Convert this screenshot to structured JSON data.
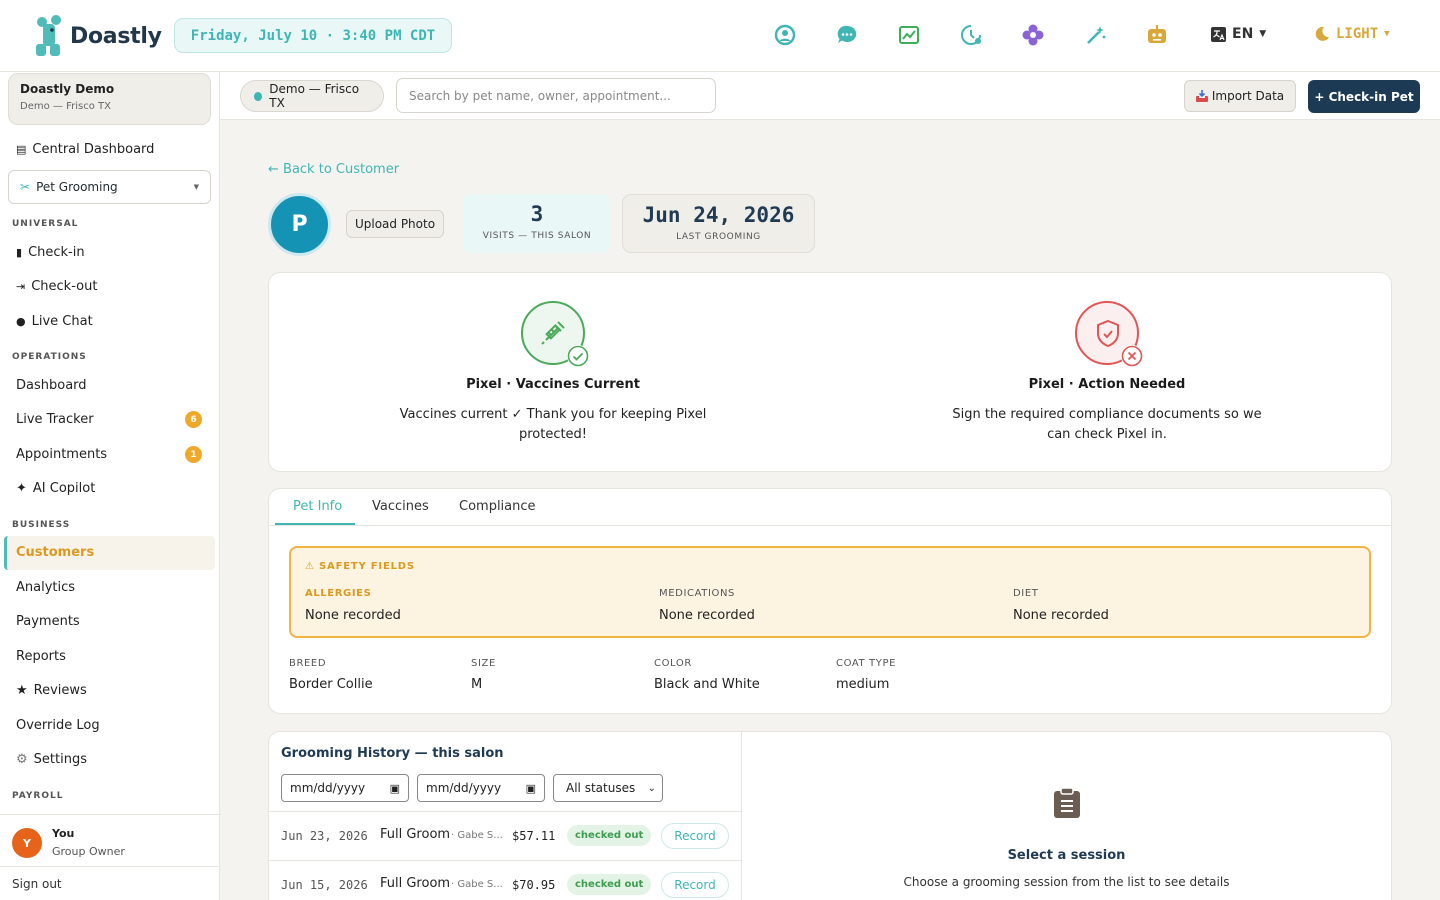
{
  "app": {
    "name": "Doastly",
    "datetime": "Friday, July 10 · 3:40 PM CDT"
  },
  "topbar": {
    "lang": "EN",
    "theme": "LIGHT",
    "icons": [
      "user-circle-icon",
      "chat-bubble-icon",
      "chart-icon",
      "clock-icon",
      "flower-icon",
      "magic-wand-icon",
      "robot-icon"
    ]
  },
  "sidebar": {
    "org_name": "Doastly Demo",
    "org_sub": "Demo — Frisco TX",
    "central": "Central Dashboard",
    "module": "Pet Grooming",
    "sections": {
      "universal": "UNIVERSAL",
      "operations": "OPERATIONS",
      "business": "BUSINESS",
      "payroll": "PAYROLL"
    },
    "universal": [
      "Check-in",
      "Check-out",
      "Live Chat"
    ],
    "operations": [
      {
        "label": "Dashboard",
        "badge": ""
      },
      {
        "label": "Live Tracker",
        "badge": "6"
      },
      {
        "label": "Appointments",
        "badge": "1"
      },
      {
        "label": "AI Copilot",
        "badge": ""
      }
    ],
    "business": [
      "Customers",
      "Analytics",
      "Payments",
      "Reports",
      "Reviews",
      "Override Log",
      "Settings"
    ],
    "active": "Customers",
    "user": {
      "initial": "Y",
      "name": "You",
      "role": "Group Owner"
    },
    "signout": "Sign out"
  },
  "subbar": {
    "location": "Demo — Frisco TX",
    "search_placeholder": "Search by pet name, owner, appointment...",
    "import_label": "Import Data",
    "checkin_label": "+ Check-in Pet"
  },
  "pet": {
    "back": "← Back to Customer",
    "initial": "P",
    "upload": "Upload Photo",
    "visits_value": "3",
    "visits_label": "VISITS — THIS SALON",
    "last_value": "Jun 24, 2026",
    "last_label": "LAST GROOMING"
  },
  "status": {
    "vaccine_title": "Pixel · Vaccines Current",
    "vaccine_desc": "Vaccines current ✓ Thank you for keeping Pixel protected!",
    "compliance_title": "Pixel · Action Needed",
    "compliance_desc": "Sign the required compliance documents so we can check Pixel in."
  },
  "tabs": [
    "Pet Info",
    "Vaccines",
    "Compliance"
  ],
  "safety": {
    "header": "⚠ SAFETY FIELDS",
    "allergies_label": "ALLERGIES",
    "allergies_value": "None recorded",
    "medications_label": "MEDICATIONS",
    "medications_value": "None recorded",
    "diet_label": "DIET",
    "diet_value": "None recorded"
  },
  "info": {
    "breed_label": "BREED",
    "breed_value": "Border Collie",
    "size_label": "SIZE",
    "size_value": "M",
    "color_label": "COLOR",
    "color_value": "Black and White",
    "coat_label": "COAT TYPE",
    "coat_value": "medium"
  },
  "history": {
    "title": "Grooming History — this salon",
    "date_placeholder": "mm/dd/yyyy",
    "status_select": "All statuses",
    "rows": [
      {
        "date": "Jun 23, 2026",
        "service": "Full Groom",
        "by": "· Gabe S...",
        "amount": "$57.11",
        "status": "checked out",
        "action": "Record"
      },
      {
        "date": "Jun 15, 2026",
        "service": "Full Groom",
        "by": "· Gabe S...",
        "amount": "$70.95",
        "status": "checked out",
        "action": "Record"
      }
    ]
  },
  "detail": {
    "title": "Select a session",
    "desc": "Choose a grooming session from the list to see details"
  }
}
